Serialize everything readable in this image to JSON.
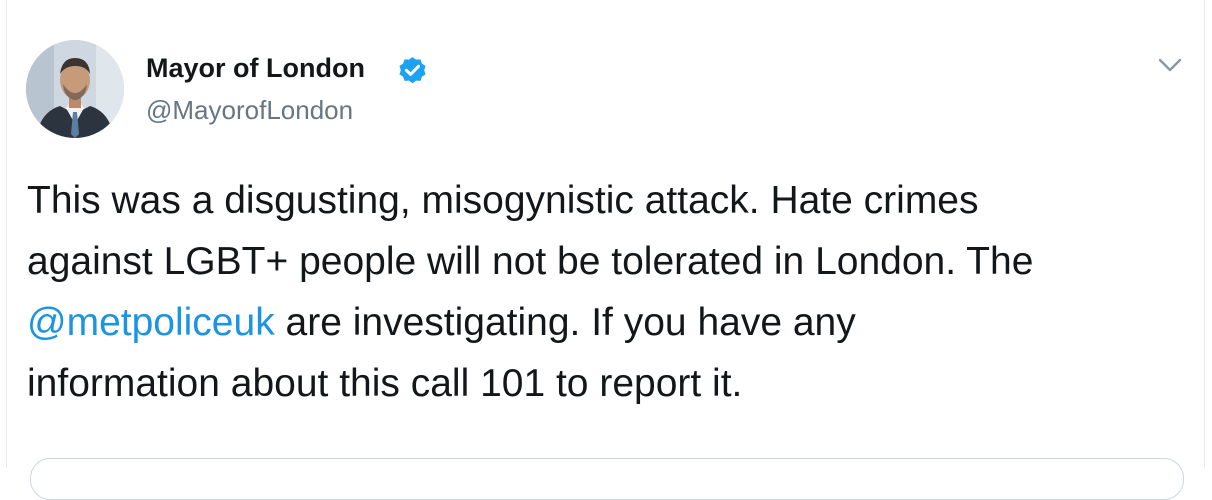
{
  "author": {
    "display_name": "Mayor of London",
    "handle": "@MayorofLondon",
    "verified": true,
    "avatar_icon": "profile-photo"
  },
  "tweet": {
    "line1": "This was a disgusting, misogynistic attack. Hate crimes",
    "line2": "against LGBT+ people will not be tolerated in London. The",
    "mention": "@metpoliceuk",
    "line3_rest": " are investigating. If you have any",
    "line4": "information about this call 101 to report it."
  },
  "icons": {
    "verified": "verified-badge-icon",
    "menu": "chevron-down-icon"
  },
  "colors": {
    "text": "#14171a",
    "secondary": "#657786",
    "link": "#1b95e0",
    "verified": "#1da1f2",
    "border": "#e6ecf0"
  }
}
